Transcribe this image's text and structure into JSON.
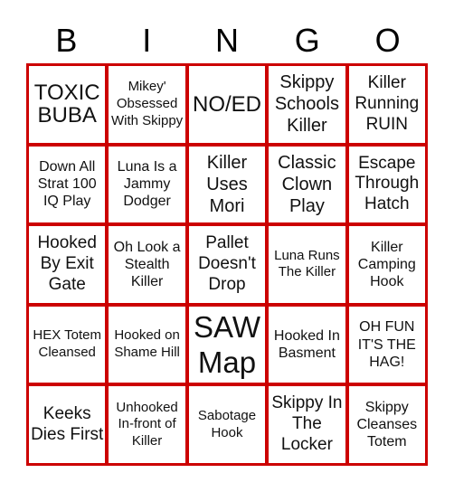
{
  "header": {
    "letters": [
      "B",
      "I",
      "N",
      "G",
      "O"
    ]
  },
  "colors": {
    "grid_border": "#cc0000",
    "cell_bg": "#ffffff",
    "text": "#111111"
  },
  "cells": [
    [
      "TOXIC BUBA",
      "Mikey' Obsessed With Skippy",
      "NO/ED",
      "Skippy Schools Killer",
      "Killer Running RUIN"
    ],
    [
      "Down All Strat 100 IQ Play",
      "Luna Is a Jammy Dodger",
      "Killer Uses Mori",
      "Classic Clown Play",
      "Escape Through Hatch"
    ],
    [
      "Hooked By Exit Gate",
      "Oh Look a Stealth Killer",
      "Pallet Doesn't Drop",
      "Luna Runs The Killer",
      "Killer Camping Hook"
    ],
    [
      "HEX Totem Cleansed",
      "Hooked on Shame Hill",
      "SAW Map",
      "Hooked In Basment",
      "OH FUN IT'S THE HAG!"
    ],
    [
      "Keeks Dies First",
      "Unhooked In-front of Killer",
      "Sabotage Hook",
      "Skippy In The Locker",
      "Skippy Cleanses Totem"
    ]
  ]
}
